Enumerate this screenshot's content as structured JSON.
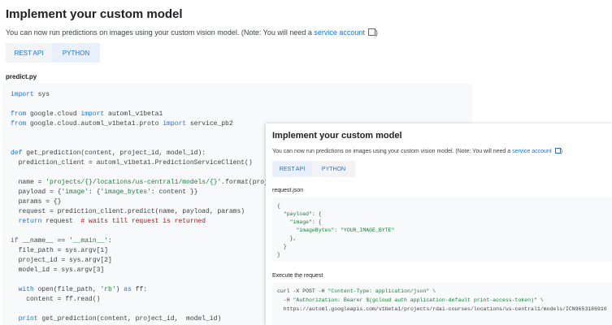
{
  "back": {
    "title": "Implement your custom model",
    "desc_prefix": "You can now run predictions on images using your custom vision model. (Note: You will need a ",
    "desc_link": "service account",
    "desc_suffix": ")",
    "tabs": [
      "REST API",
      "PYTHON"
    ],
    "file_name": "predict.py",
    "code": {
      "l1a": "import",
      "l1b": " sys",
      "l2a": "from",
      "l2b": " google.cloud ",
      "l2c": "import",
      "l2d": " automl_v1beta1",
      "l3a": "from",
      "l3b": " google.cloud.automl_v1beta1.proto ",
      "l3c": "import",
      "l3d": " service_pb2",
      "l4a": "def",
      "l4b": " get_prediction(content, project_id, model_id):",
      "l5": "  prediction_client = automl_v1beta1.PredictionServiceClient()",
      "l6a": "  name = ",
      "l6b": "'projects/{}/locations/us-central1/models/{}'",
      "l6c": ".format(project_id, model_id)",
      "l7a": "  payload = {",
      "l7b": "'image'",
      "l7c": ": {",
      "l7d": "'image_bytes'",
      "l7e": ": content }}",
      "l8": "  params = {}",
      "l9": "  request = prediction_client.predict(name, payload, params)",
      "l10a": "  return",
      "l10b": " request  ",
      "l10c": "# waits till request is returned",
      "l11a": "if",
      "l11b": " __name__ == ",
      "l11c": "'__main__'",
      "l11d": ":",
      "l12": "  file_path = sys.argv[1]",
      "l13": "  project_id = sys.argv[2]",
      "l14": "  model_id = sys.argv[3]",
      "l15a": "  with",
      "l15b": " open(file_path, ",
      "l15c": "'rb'",
      "l15d": ") ",
      "l15e": "as",
      "l15f": " ff:",
      "l16": "    content = ff.read()",
      "l17a": "  print",
      "l17b": " get_prediction(content, project_id,  model_id)"
    }
  },
  "front": {
    "title": "Implement your custom model",
    "desc_prefix": "You can now run predictions on images using your custom vision model. (Note: You will need a ",
    "desc_link": "service account",
    "desc_suffix": ")",
    "tabs": [
      "REST API",
      "PYTHON"
    ],
    "file_name": "request.json",
    "json": {
      "j1": "{",
      "j2a": "  ",
      "j2b": "\"payload\"",
      "j2c": ": {",
      "j3a": "    ",
      "j3b": "\"image\"",
      "j3c": ": {",
      "j4a": "      ",
      "j4b": "\"imageBytes\"",
      "j4c": ": ",
      "j4d": "\"YOUR_IMAGE_BYTE\"",
      "j5": "    },",
      "j6": "  }",
      "j7": "}"
    },
    "execute_label": "Execute the request",
    "curl": {
      "c1a": "curl -X POST -H ",
      "c1b": "\"Content-Type: application/json\"",
      "c1c": " \\",
      "c2a": "  -H ",
      "c2b": "\"Authorization: Bearer $(gcloud auth application-default print-access-token)\"",
      "c2c": " \\",
      "c3": "  https://automl.googleapis.com/v1beta1/projects/rdai-courses/locations/us-central1/models/ICN9653186910"
    }
  }
}
